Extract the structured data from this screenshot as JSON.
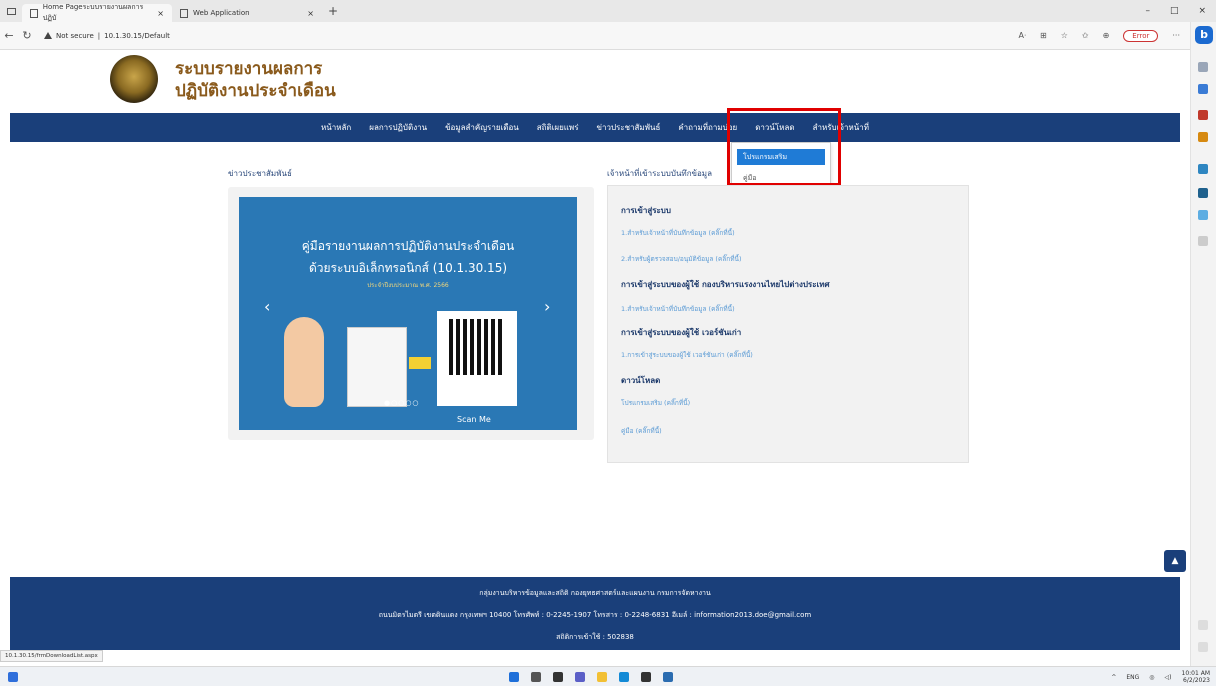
{
  "browser": {
    "tabs": [
      {
        "label": "Home Pageระบบรายงานผลการปฏิบั"
      },
      {
        "label": "Web Application"
      }
    ],
    "new_tab": "+",
    "window_controls": [
      "–",
      "□",
      "×"
    ],
    "address": {
      "security": "Not secure",
      "url": "10.1.30.15/Default"
    },
    "error_button": "Error",
    "status_url": "10.1.30.15/frmDownloadList.aspx"
  },
  "site": {
    "title_line1": "ระบบรายงานผลการ",
    "title_line2": "ปฏิบัติงานประจำเดือน"
  },
  "nav": {
    "items": [
      "หน้าหลัก",
      "ผลการปฏิบัติงาน",
      "ข้อมูลสำคัญรายเดือน",
      "สถิติเผยแพร่",
      "ข่าวประชาสัมพันธ์",
      "คำถามที่ถามบ่อย",
      "ดาวน์โหลด",
      "สำหรับเจ้าหน้าที่"
    ],
    "dropdown": [
      "โปรแกรมเสริม",
      "คู่มือ"
    ]
  },
  "news": {
    "title": "ข่าวประชาสัมพันธ์",
    "banner_line1": "คู่มือรายงานผลการปฏิบัติงานประจำเดือน",
    "banner_line2": "ด้วยระบบอิเล็กทรอนิกส์ (10.1.30.15)",
    "banner_line3": "ประจำปีงบประมาณ พ.ศ. 2566",
    "scan_label": "Scan Me",
    "prev": "‹",
    "next": "›",
    "dots": "●○○○○"
  },
  "staff": {
    "title": "เจ้าหน้าที่เข้าระบบบันทึกข้อมูล",
    "h1": "การเข้าสู่ระบบ",
    "l1": "1.สำหรับเจ้าหน้าที่บันทึกข้อมูล (คลิ๊กที่นี้)",
    "l2": "2.สำหรับผู้ตรวจสอบ/อนุมัติข้อมูล (คลิ๊กที่นี้)",
    "h2": "การเข้าสู่ระบบของผู้ใช้ กองบริหารแรงงานไทยไปต่างประเทศ",
    "l3": "1.สำหรับเจ้าหน้าที่บันทึกข้อมูล (คลิ๊กที่นี้)",
    "h3": "การเข้าสู่ระบบของผู้ใช้ เวอร์ชันเก่า",
    "l4": "1.การเข้าสู่ระบบของผู้ใช้ เวอร์ชันเก่า (คลิ๊กที่นี้)",
    "h4": "ดาวน์โหลด",
    "l5": "โปรแกรมเสริม (คลิ๊กที่นี้)",
    "l6": "คู่มือ (คลิ๊กที่นี้)"
  },
  "footer": {
    "line1": "กลุ่มงานบริหารข้อมูลและสถิติ กองยุทธศาสตร์และแผนงาน กรมการจัดหางาน",
    "line2": "ถนนมิตรไมตรี เขตดินแดง กรุงเทพฯ 10400 โทรศัพท์ : 0-2245-1907 โทรสาร : 0-2248-6831 อีเมล์ : information2013.doe@gmail.com",
    "line3": "สถิติการเข้าใช้ : 502838"
  },
  "taskbar": {
    "lang": "ENG",
    "time": "10:01 AM",
    "date": "6/2/2023"
  },
  "colors": {
    "nav": "#1a3f7a",
    "highlight": "#e00000",
    "dropdown_active": "#1f7bd6",
    "title": "#8a5a1c"
  }
}
